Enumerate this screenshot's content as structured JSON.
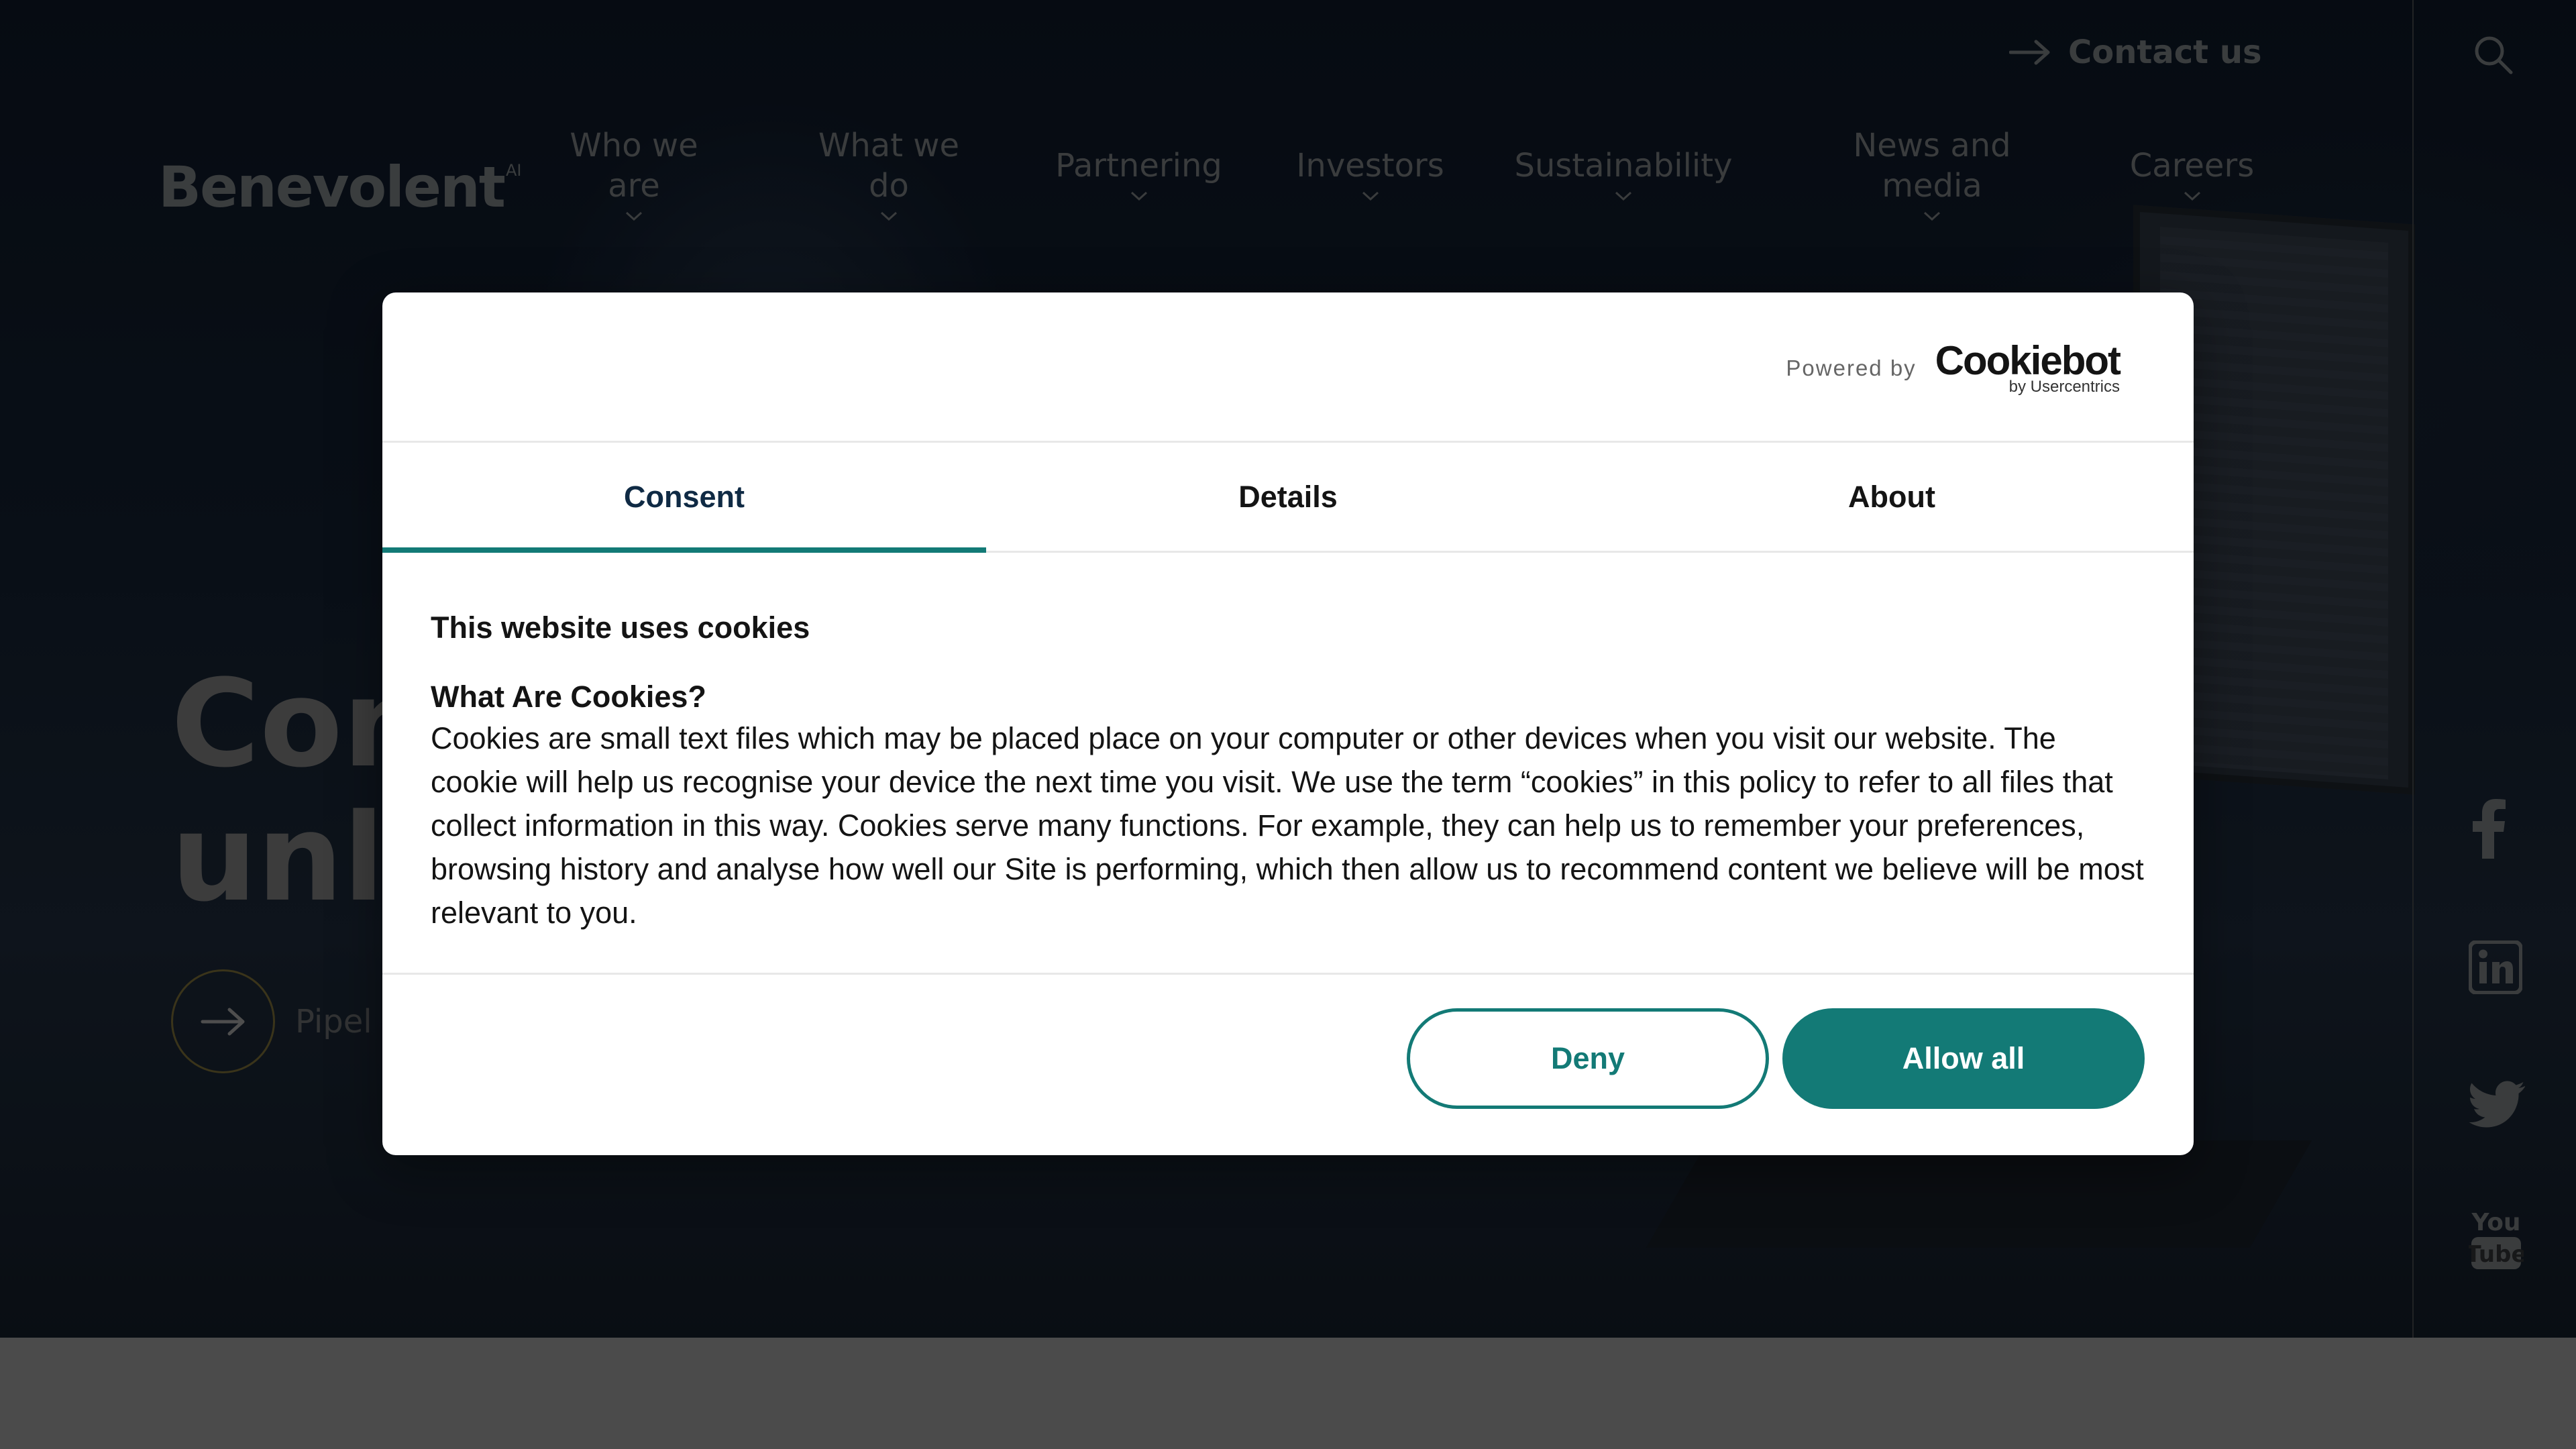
{
  "site": {
    "logo_text": "Benevolent",
    "logo_sup": "AI",
    "contact_label": "Contact us",
    "nav": [
      {
        "label": "Who we are"
      },
      {
        "label": "What we do"
      },
      {
        "label": "Partnering"
      },
      {
        "label": "Investors"
      },
      {
        "label": "Sustainability"
      },
      {
        "label": "News and media"
      },
      {
        "label": "Careers"
      }
    ],
    "hero_title_line1": "Con",
    "hero_title_line2": "unl",
    "hero_link": "Pipel",
    "social_icons": [
      "facebook-icon",
      "linkedin-icon",
      "twitter-icon",
      "youtube-icon"
    ]
  },
  "dialog": {
    "powered_by": "Powered by",
    "brand_name": "Cookiebot",
    "brand_sub": "by Usercentrics",
    "tabs": [
      {
        "label": "Consent",
        "active": true
      },
      {
        "label": "Details",
        "active": false
      },
      {
        "label": "About",
        "active": false
      }
    ],
    "heading": "This website uses cookies",
    "subheading": "What Are Cookies?",
    "text": "Cookies are small text files which may be placed place on your computer or other devices when you visit our website. The cookie will help us recognise your device the next time you visit. We use the term “cookies” in this policy to refer to all files that collect information in this way. Cookies serve many functions. For example, they can help us to remember your preferences, browsing history and analyse how well our Site is performing, which then allow us to recommend content we believe will be most relevant to you.",
    "deny_label": "Deny",
    "allow_label": "Allow all"
  },
  "colors": {
    "accent": "#137a76",
    "tab_active_text": "#0f2a44",
    "overlay": "rgba(0,0,0,0.45)"
  }
}
